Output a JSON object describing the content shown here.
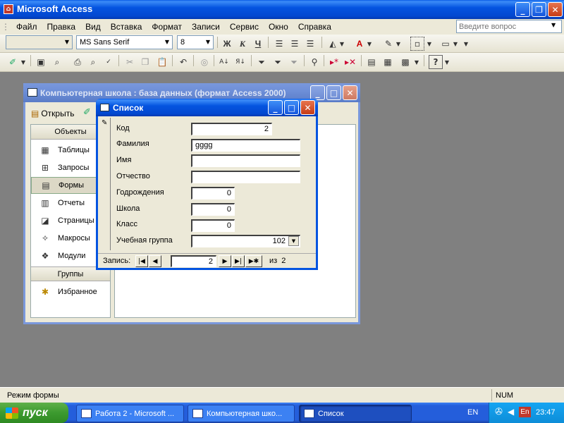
{
  "app": {
    "title": "Microsoft Access"
  },
  "menu": [
    "Файл",
    "Правка",
    "Вид",
    "Вставка",
    "Формат",
    "Записи",
    "Сервис",
    "Окно",
    "Справка"
  ],
  "question_box": {
    "placeholder": "Введите вопрос"
  },
  "format_toolbar": {
    "font": "MS Sans Serif",
    "size": "8",
    "bold": "Ж",
    "italic": "К",
    "underline": "Ч"
  },
  "db_window": {
    "title": "Компьютерная школа : база данных (формат Access 2000)",
    "open_label": "Открыть",
    "objects_header": "Объекты",
    "objects": [
      "Таблицы",
      "Запросы",
      "Формы",
      "Отчеты",
      "Страницы",
      "Макросы",
      "Модули"
    ],
    "selected_object": "Формы",
    "groups_header": "Группы",
    "groups": [
      "Избранное"
    ]
  },
  "form": {
    "title": "Список",
    "fields": [
      {
        "label": "Код",
        "value": "2"
      },
      {
        "label": "Фамилия",
        "value": "gggg"
      },
      {
        "label": "Имя",
        "value": ""
      },
      {
        "label": "Отчество",
        "value": ""
      },
      {
        "label": "Годрождения",
        "value": "0"
      },
      {
        "label": "Школа",
        "value": "0"
      },
      {
        "label": "Класс",
        "value": "0"
      },
      {
        "label": "Учебная группа",
        "value": "102"
      }
    ],
    "nav": {
      "label": "Запись:",
      "current": "2",
      "of_text": "из  2"
    }
  },
  "status": {
    "mode": "Режим формы",
    "num": "NUM"
  },
  "taskbar": {
    "start": "пуск",
    "tasks": [
      "Работа 2 - Microsoft ...",
      "Компьютерная шко...",
      "Список"
    ],
    "lang": "EN",
    "time": "23:47",
    "tray_lang": "En"
  },
  "colors": {
    "accent": "#0454e0",
    "taskbar": "#245edb",
    "start": "#3c9a2f",
    "window_bg": "#ece9d8",
    "desktop": "#808080"
  }
}
